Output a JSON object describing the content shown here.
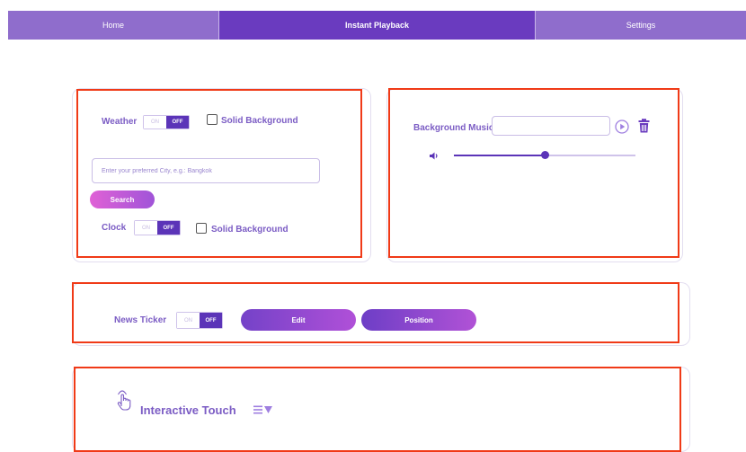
{
  "nav": {
    "tabs": [
      {
        "label": "Home"
      },
      {
        "label": "Instant Playback"
      },
      {
        "label": "Settings"
      }
    ]
  },
  "weather_panel": {
    "weather_label": "Weather",
    "toggle_on": "ON",
    "toggle_off": "OFF",
    "solid_bg_label": "Solid Background",
    "city_placeholder": "Enter your preferred City, e.g.: Bangkok",
    "search_label": "Search",
    "clock_label": "Clock",
    "clock_toggle_on": "ON",
    "clock_toggle_off": "OFF",
    "clock_solid_bg_label": "Solid Background"
  },
  "music_panel": {
    "bg_music_label": "Background Music",
    "music_value": "",
    "volume_level": 0.5
  },
  "news_panel": {
    "news_label": "News Ticker",
    "toggle_on": "ON",
    "toggle_off": "OFF",
    "edit_label": "Edit",
    "position_label": "Position"
  },
  "touch_panel": {
    "title": "Interactive Touch"
  },
  "colors": {
    "accent": "#6a3bbf",
    "label": "#7b5cc4",
    "highlight_box": "#f03a17"
  }
}
